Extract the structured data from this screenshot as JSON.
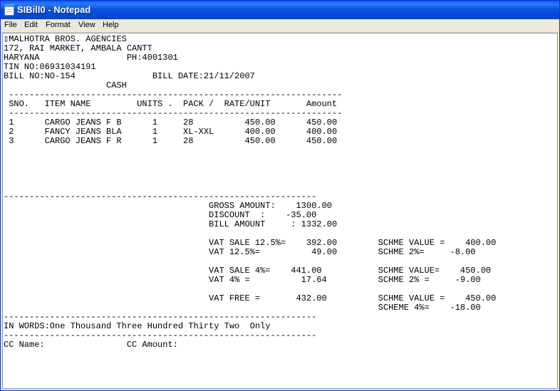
{
  "window": {
    "title": "SIBill0 - Notepad",
    "app_icon": "notepad-icon"
  },
  "menu": {
    "items": [
      "File",
      "Edit",
      "Format",
      "View",
      "Help"
    ]
  },
  "editor": {
    "text": "▯MALHOTRA BROS. AGENCIES\n172, RAI MARKET, AMBALA CANTT\nHARYANA                 PH:4001301\nTIN NO:06931034191\nBILL NO:NO-154               BILL DATE:21/11/2007\n                    CASH\n -----------------------------------------------------------------\n SNO.   ITEM NAME         UNITS .  PACK /  RATE/UNIT       Amount\n -----------------------------------------------------------------\n 1      CARGO JEANS F B      1     28          450.00      450.00\n 2      FANCY JEANS BLA      1     XL-XXL      400.00      400.00\n 3      CARGO JEANS F R      1     28          450.00      450.00\n\n\n\n\n\n-------------------------------------------------------------\n                                        GROSS AMOUNT:    1300.00\n                                        DISCOUNT  :    -35.00\n                                        BILL AMOUNT     : 1332.00\n\n                                        VAT SALE 12.5%=    392.00        SCHME VALUE =    400.00\n                                        VAT 12.5%=          49.00        SCHME 2%=     -8.00\n\n                                        VAT SALE 4%=    441.00           SCHME VALUE=    450.00\n                                        VAT 4% =          17.64          SCHME 2% =     -9.00\n\n                                        VAT FREE =       432.00          SCHME VALUE =    450.00\n                                                                         SCHEME 4%=    -18.00\n-------------------------------------------------------------\nIN WORDS:One Thousand Three Hundred Thirty Two  Only\n-------------------------------------------------------------\nCC Name:                CC Amount:"
  }
}
